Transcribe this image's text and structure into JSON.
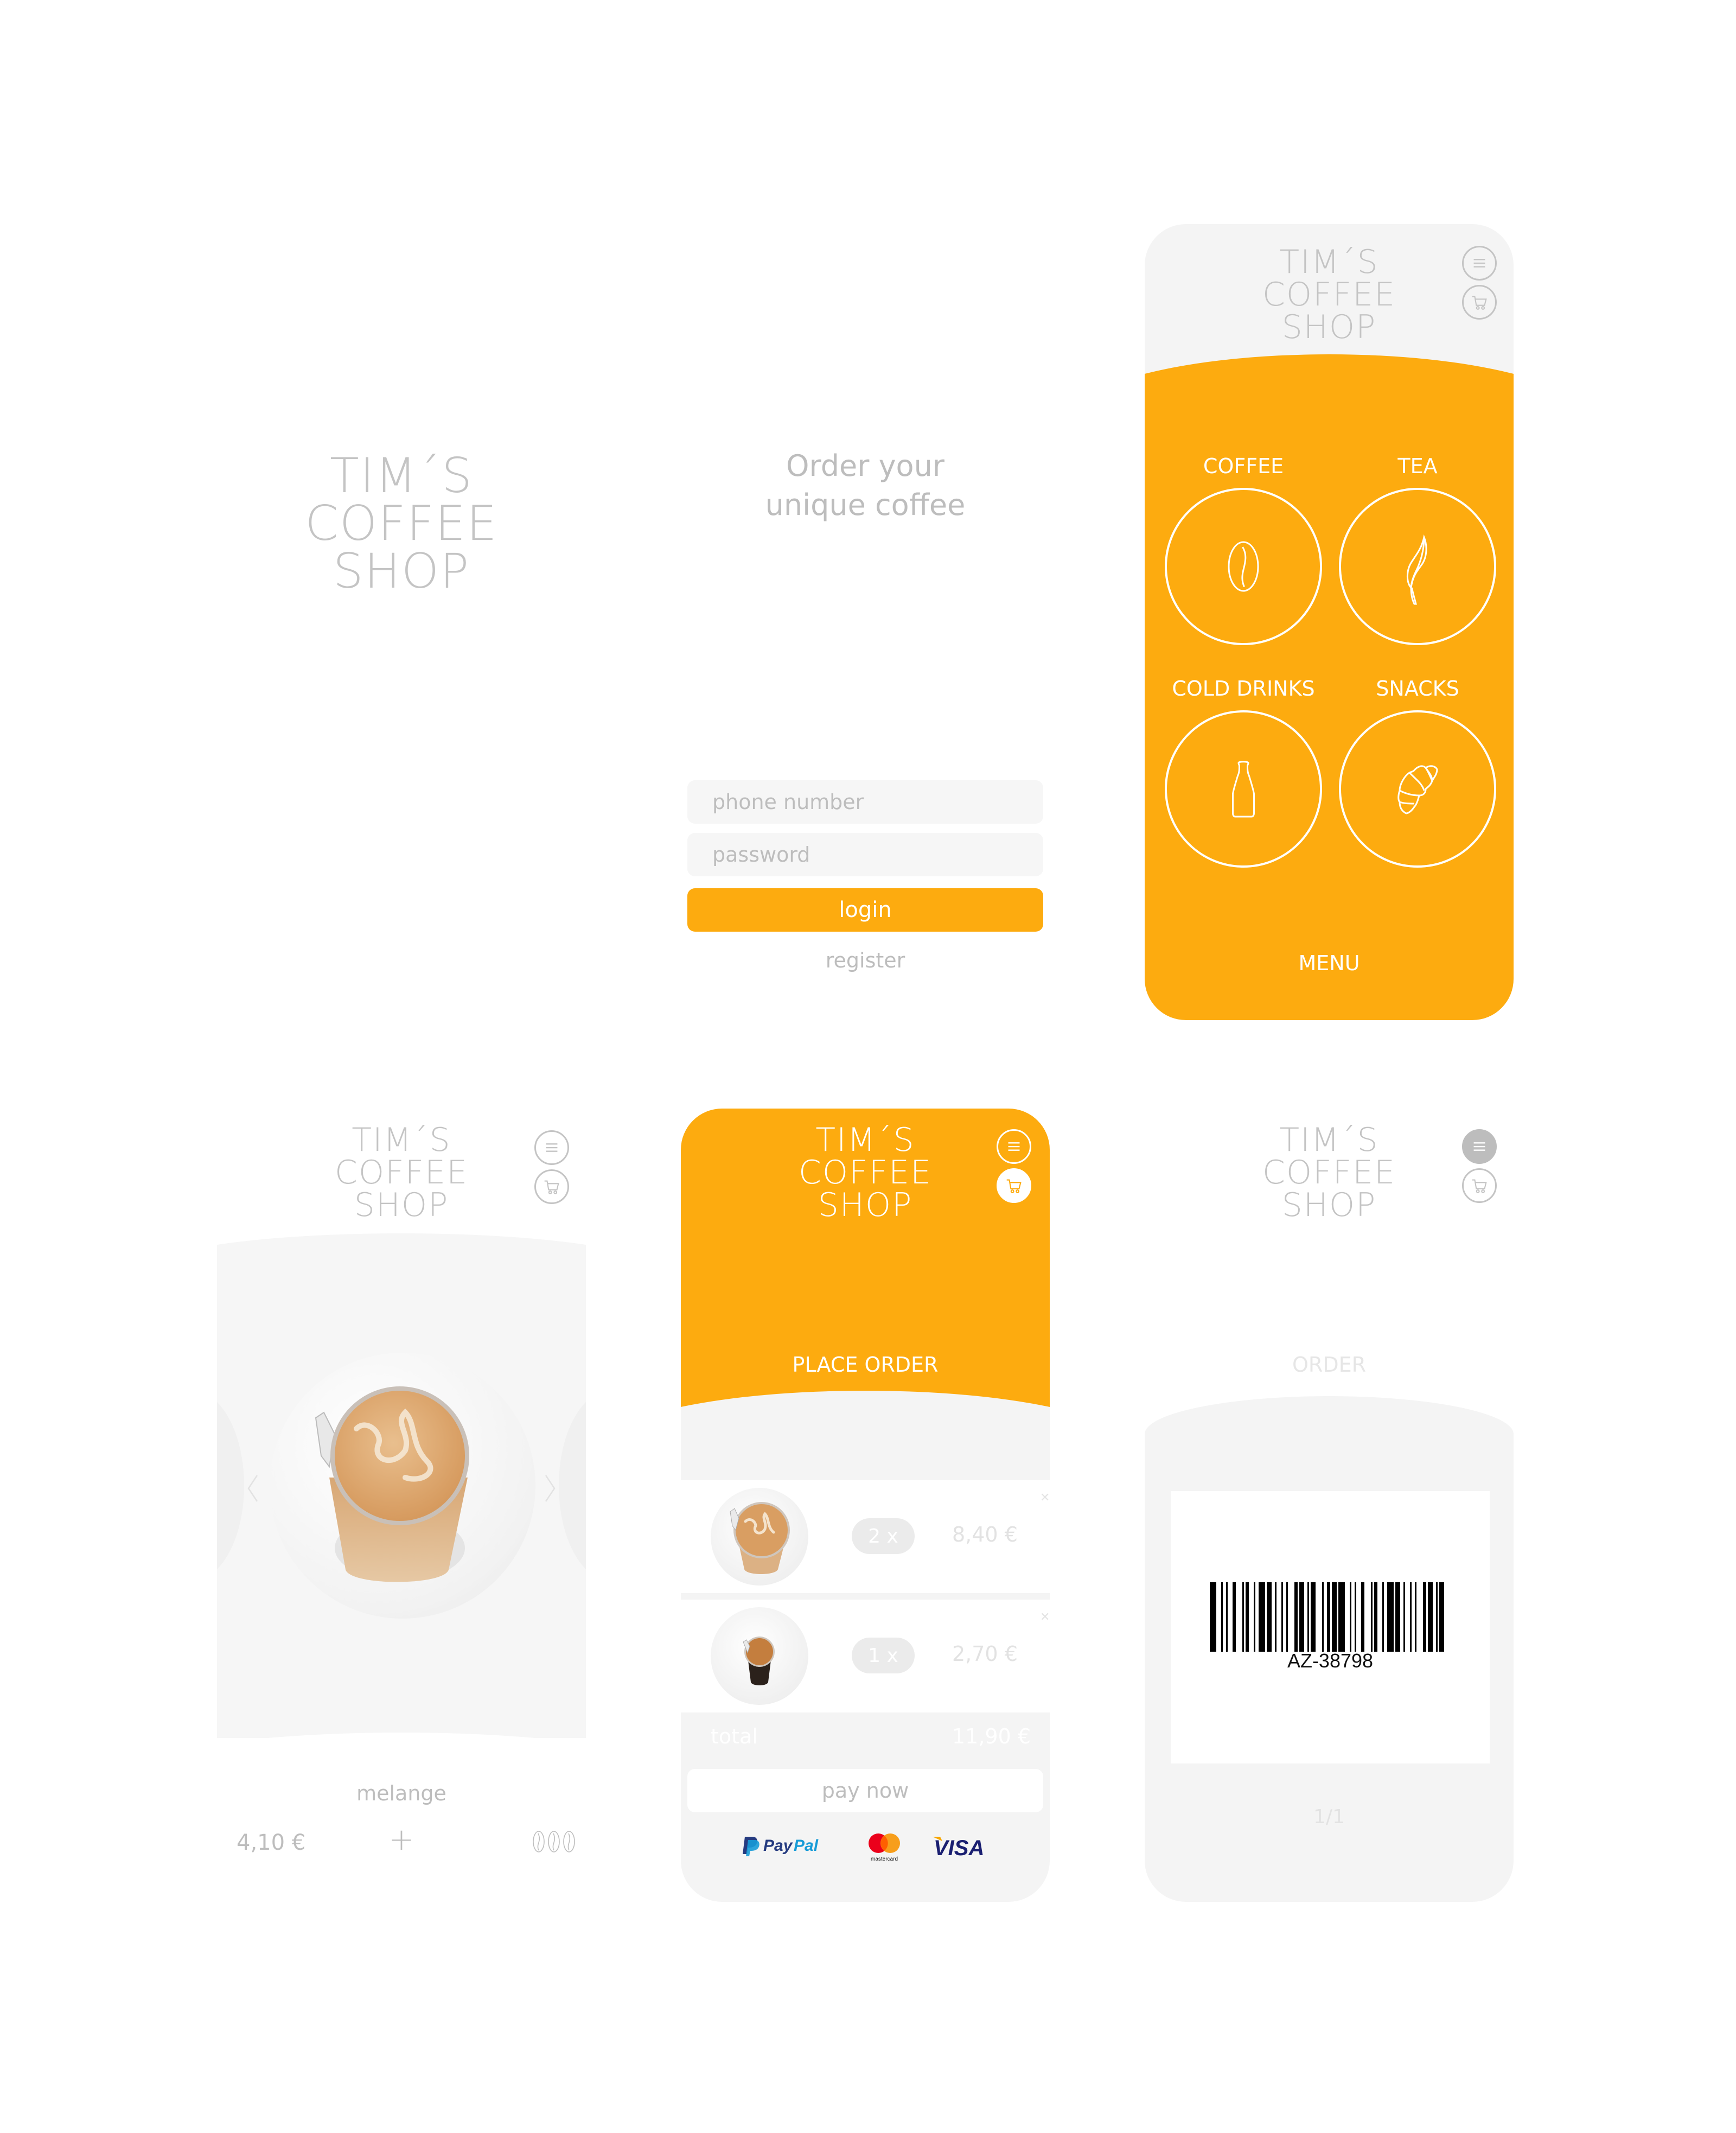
{
  "brand": {
    "logo_lines": [
      "TIM´S",
      "COFFEE",
      "SHOP"
    ],
    "accent_color": "#fdab0f",
    "muted_text_color": "#bdbdbd",
    "panel_color": "#f4f4f4"
  },
  "splash": {},
  "login": {
    "tagline_line1": "Order your",
    "tagline_line2": "unique coffee",
    "phone_placeholder": "phone number",
    "password_placeholder": "password",
    "login_label": "login",
    "register_label": "register"
  },
  "menu_screen": {
    "categories": [
      {
        "label": "COFFEE",
        "icon": "coffee-bean-icon"
      },
      {
        "label": "TEA",
        "icon": "tea-leaf-icon"
      },
      {
        "label": "COLD DRINKS",
        "icon": "bottle-icon"
      },
      {
        "label": "SNACKS",
        "icon": "croissant-icon"
      }
    ],
    "footer_label": "MENU"
  },
  "product_screen": {
    "name": "melange",
    "price": "4,10 €",
    "add_label": "+",
    "strength_beans": 3
  },
  "cart_screen": {
    "title": "PLACE ORDER",
    "items": [
      {
        "product": "melange",
        "quantity": "2 x",
        "price": "8,40 €"
      },
      {
        "product": "espresso",
        "quantity": "1 x",
        "price": "2,70 €"
      }
    ],
    "total_label": "total",
    "total_value": "11,90 €",
    "pay_label": "pay now",
    "payment_methods": [
      {
        "name": "PayPal",
        "label_a": "Pay",
        "label_b": "Pal"
      },
      {
        "name": "Mastercard",
        "label": "mastercard"
      },
      {
        "name": "Visa",
        "label": "VISA"
      }
    ]
  },
  "order_screen": {
    "title": "ORDER",
    "barcode_code": "AZ-38798",
    "pager": "1/1"
  }
}
